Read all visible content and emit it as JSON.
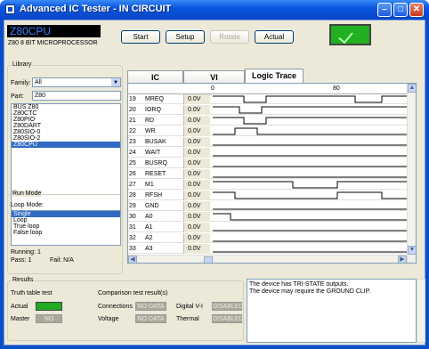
{
  "window": {
    "title": "Advanced IC Tester - IN CIRCUIT"
  },
  "device": {
    "name": "Z80CPU",
    "description": "Z80 8 BIT MICROPROCESSOR"
  },
  "toolbar": {
    "start": "Start",
    "setup": "Setup",
    "rotate": "Rotate",
    "actual": "Actual"
  },
  "status": {
    "color": "#20b020"
  },
  "library": {
    "label": "Library",
    "family_label": "Family:",
    "family_value": "All",
    "part_label": "Part:",
    "part_value": "Z80",
    "items": [
      "BUS Z80",
      "Z80CTC",
      "Z80PIO",
      "Z80DART",
      "Z80SIO-0",
      "Z80SIO-2",
      "Z80CPU"
    ],
    "selected": "Z80CPU"
  },
  "run_mode": {
    "label": "Run Mode",
    "loop_label": "Loop Mode:",
    "options": [
      "Single",
      "Loop",
      "True loop",
      "False loop"
    ],
    "selected": "Single",
    "running": "Running: 1",
    "pass": "Pass: 1",
    "fail": "Fail: N/A"
  },
  "tabs": [
    {
      "label": "IC"
    },
    {
      "label": "VI"
    },
    {
      "label": "Logic Trace"
    }
  ],
  "active_tab": "Logic Trace",
  "trace": {
    "ruler": [
      "0",
      "80"
    ],
    "signals": [
      {
        "num": "19",
        "name": "MREQ",
        "v": "0.0V"
      },
      {
        "num": "20",
        "name": "IORQ",
        "v": "0.0V"
      },
      {
        "num": "21",
        "name": "RD",
        "v": "0.0V"
      },
      {
        "num": "22",
        "name": "WR",
        "v": "0.0V"
      },
      {
        "num": "23",
        "name": "BUSAK",
        "v": "0.0V"
      },
      {
        "num": "24",
        "name": "WAIT",
        "v": "0.0V"
      },
      {
        "num": "25",
        "name": "BUSRQ",
        "v": "0.0V"
      },
      {
        "num": "26",
        "name": "RESET",
        "v": "0.0V"
      },
      {
        "num": "27",
        "name": "M1",
        "v": "0.0V"
      },
      {
        "num": "28",
        "name": "RFSH",
        "v": "0.0V"
      },
      {
        "num": "29",
        "name": "GND",
        "v": "0.0V"
      },
      {
        "num": "30",
        "name": "A0",
        "v": "0.0V"
      },
      {
        "num": "31",
        "name": "A1",
        "v": "0.0V"
      },
      {
        "num": "32",
        "name": "A2",
        "v": "0.0V"
      },
      {
        "num": "33",
        "name": "A3",
        "v": "0.0V"
      }
    ]
  },
  "results": {
    "label": "Results",
    "truth_label": "Truth table test",
    "actual_label": "Actual",
    "master_label": "Master",
    "master_value": "NO DATA",
    "comparison_label": "Comparison test result(s)",
    "connections_label": "Connections",
    "connections_value": "NO DATA",
    "voltage_label": "Voltage",
    "voltage_value": "NO DATA",
    "digital_label": "Digital V-I",
    "digital_value": "DISABLED",
    "thermal_label": "Thermal",
    "thermal_value": "DISABLED"
  },
  "messages": [
    "The device has TRI-STATE outputs.",
    "The device may require the GROUND CLIP."
  ]
}
